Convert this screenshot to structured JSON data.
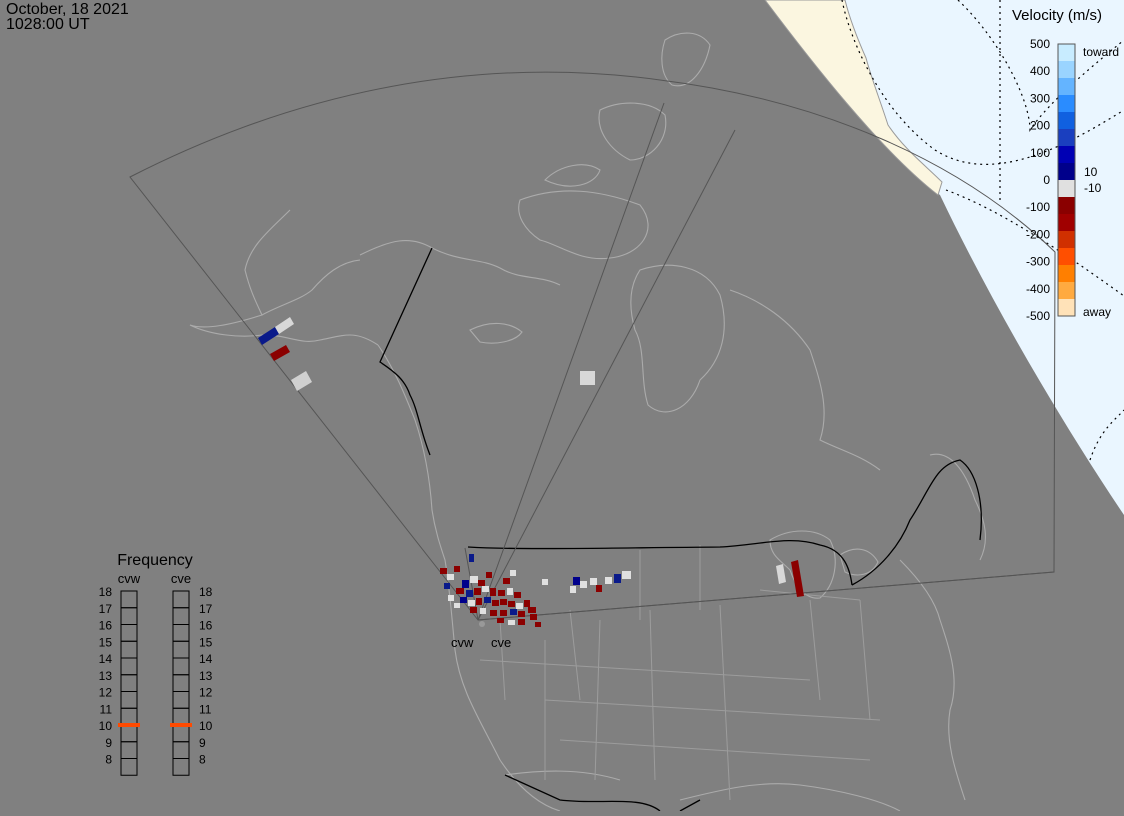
{
  "header": {
    "date": "October, 18 2021",
    "time": "1028:00 UT"
  },
  "colors": {
    "background": "#808080",
    "night_side": "#eaf6ff",
    "land_in_daylight_edge": "#fbf6e0",
    "coastline": "#a8a8a8",
    "fov_outline": "#5a5a5a",
    "border": "#000000"
  },
  "velocity_scale": {
    "title": "Velocity (m/s)",
    "toward_label": "toward",
    "away_label": "away",
    "ticks": [
      "500",
      "400",
      "300",
      "200",
      "100",
      "0",
      "-100",
      "-200",
      "-300",
      "-400",
      "-500"
    ],
    "inner_upper": "10",
    "inner_lower": "-10",
    "colors": [
      "#ffe2b8",
      "#ffaa40",
      "#ff7f00",
      "#ff4f00",
      "#d03000",
      "#a00000",
      "#8a0000",
      "#e0e0e0",
      "#00008b",
      "#0000b4",
      "#1a3fbf",
      "#1060e0",
      "#2a8cff",
      "#64b4ff",
      "#9ad4ff",
      "#c8ecff"
    ]
  },
  "radars": {
    "west_label": "cvw",
    "east_label": "cve"
  },
  "frequency_panel": {
    "title": "Frequency",
    "radar_a": "cvw",
    "radar_b": "cve",
    "levels": [
      "18",
      "17",
      "16",
      "15",
      "14",
      "13",
      "12",
      "11",
      "10",
      "9",
      "8"
    ],
    "current_mhz_a": 10.5,
    "current_mhz_b": 10.5,
    "marker_color": "#ff4a00"
  }
}
